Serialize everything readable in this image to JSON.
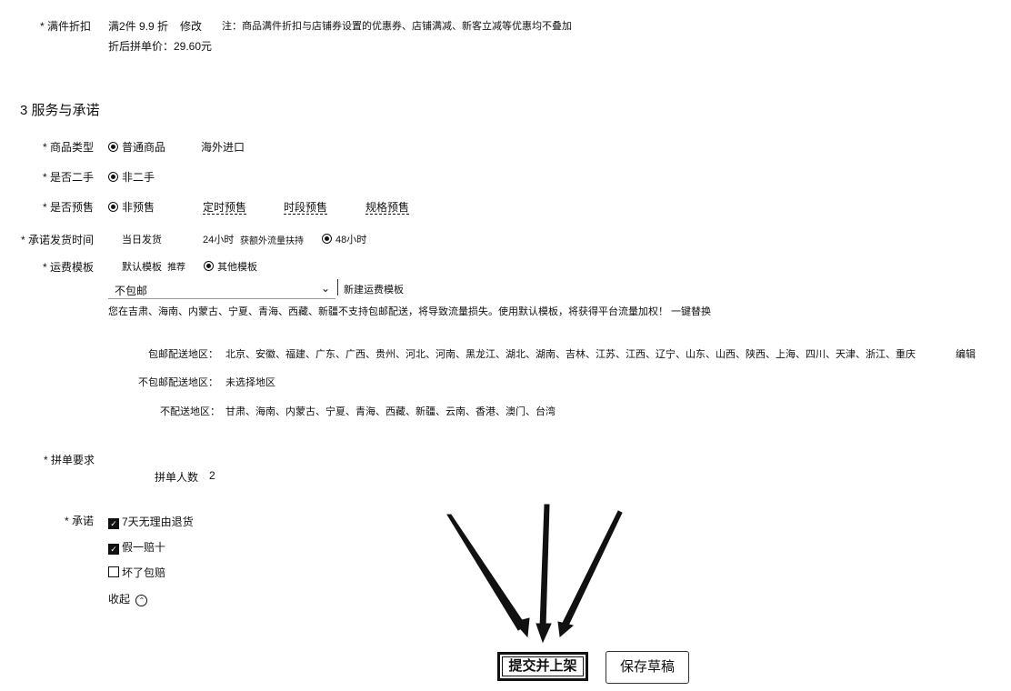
{
  "discount": {
    "label": "* 满件折扣",
    "value": "满2件 9.9 折",
    "edit": "修改",
    "note": "注：商品满件折扣与店铺券设置的优惠券、店铺满减、新客立减等优惠均不叠加",
    "price_line": "折后拼单价：29.60元"
  },
  "section": {
    "title": "3  服务与承诺"
  },
  "product_type": {
    "label": "* 商品类型",
    "options": [
      "普通商品",
      "海外进口"
    ],
    "selected": 0
  },
  "second_hand": {
    "label": "* 是否二手",
    "options": [
      "非二手"
    ],
    "selected": 0
  },
  "presale": {
    "label": "* 是否预售",
    "options": [
      "非预售",
      "定时预售",
      "时段预售",
      "规格预售"
    ],
    "selected": 0
  },
  "ship_time": {
    "label": "* 承诺发货时间",
    "options": [
      "当日发货",
      "24小时",
      "48小时"
    ],
    "hint": "获额外流量扶持",
    "selected": 2
  },
  "freight": {
    "label": "* 运费模板",
    "options": [
      "默认模板",
      "其他模板"
    ],
    "tag": "推荐",
    "selected": 1,
    "select_value": "不包邮",
    "new_link": "新建运费模板",
    "warning": "您在吉肃、海南、内蒙古、宁夏、青海、西藏、新疆不支持包邮配送，将导致流量损失。使用默认模板，将获得平台流量加权！ 一键替换"
  },
  "regions": {
    "free_label": "包邮配送地区：",
    "free_value": "北京、安徽、福建、广东、广西、贵州、河北、河南、黑龙江、湖北、湖南、吉林、江苏、江西、辽宁、山东、山西、陕西、上海、四川、天津、浙江、重庆",
    "edit": "编辑",
    "nonfree_label": "不包邮配送地区：",
    "nonfree_value": "未选择地区",
    "none_label": "不配送地区：",
    "none_value": "甘肃、海南、内蒙古、宁夏、青海、西藏、新疆、云南、香港、澳门、台湾"
  },
  "group": {
    "label": "* 拼单要求",
    "count_label": "拼单人数",
    "count_value": "2"
  },
  "promise": {
    "label": "* 承诺",
    "items": [
      {
        "text": "7天无理由退货",
        "checked": true
      },
      {
        "text": "假一赔十",
        "checked": true
      },
      {
        "text": "坏了包赔",
        "checked": false
      }
    ],
    "collapse": "收起"
  },
  "actions": {
    "submit": "提交并上架",
    "draft": "保存草稿"
  }
}
